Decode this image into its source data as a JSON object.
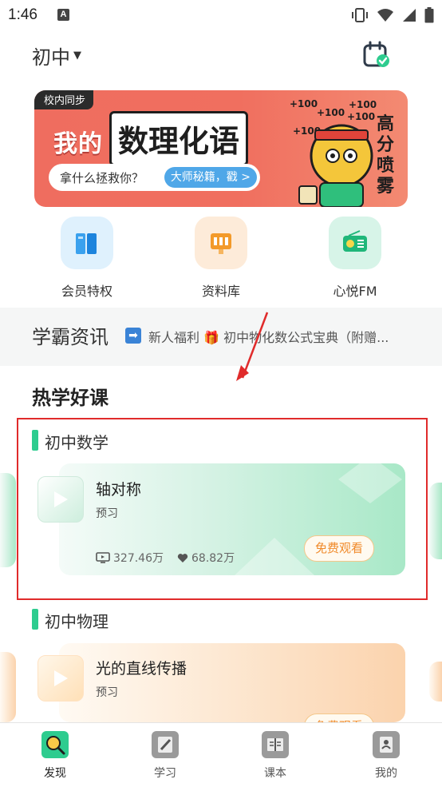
{
  "status_bar": {
    "time": "1:46",
    "a_badge": "A"
  },
  "header": {
    "grade": "初中"
  },
  "banner": {
    "tag": "校内同步",
    "title_prefix": "我的",
    "title_main": "数理化语",
    "pill_text": "拿什么拯救你？",
    "pill_button": "大师秘籍，戳 >",
    "plus_marks": [
      "+100",
      "+100",
      "+100",
      "+100",
      "+100"
    ],
    "side_text": "高分喷雾"
  },
  "tiles": [
    {
      "label": "会员特权",
      "icon": "membership-book-icon"
    },
    {
      "label": "资料库",
      "icon": "library-icon"
    },
    {
      "label": "心悦FM",
      "icon": "radio-icon"
    }
  ],
  "news": {
    "title": "学霸资讯",
    "text_part1": "新人福利",
    "text_part2": "初中物化数公式宝典（附赠..."
  },
  "hot": {
    "title": "热学好课",
    "subjects": [
      {
        "name": "初中数学",
        "course": "轴对称",
        "type": "预习",
        "views": "327.46万",
        "likes": "68.82万",
        "button": "免费观看"
      },
      {
        "name": "初中物理",
        "course": "光的直线传播",
        "type": "预习",
        "button": "免费观看"
      }
    ]
  },
  "nav": [
    {
      "label": "发现",
      "icon": "discover-icon",
      "active": true
    },
    {
      "label": "学习",
      "icon": "study-icon",
      "active": false
    },
    {
      "label": "课本",
      "icon": "textbook-icon",
      "active": false
    },
    {
      "label": "我的",
      "icon": "profile-icon",
      "active": false
    }
  ],
  "colors": {
    "accent_green": "#2ecc8f",
    "button_orange": "#f08a2a",
    "highlight_red": "#e02b2b",
    "banner_red": "#ef6d5f"
  }
}
